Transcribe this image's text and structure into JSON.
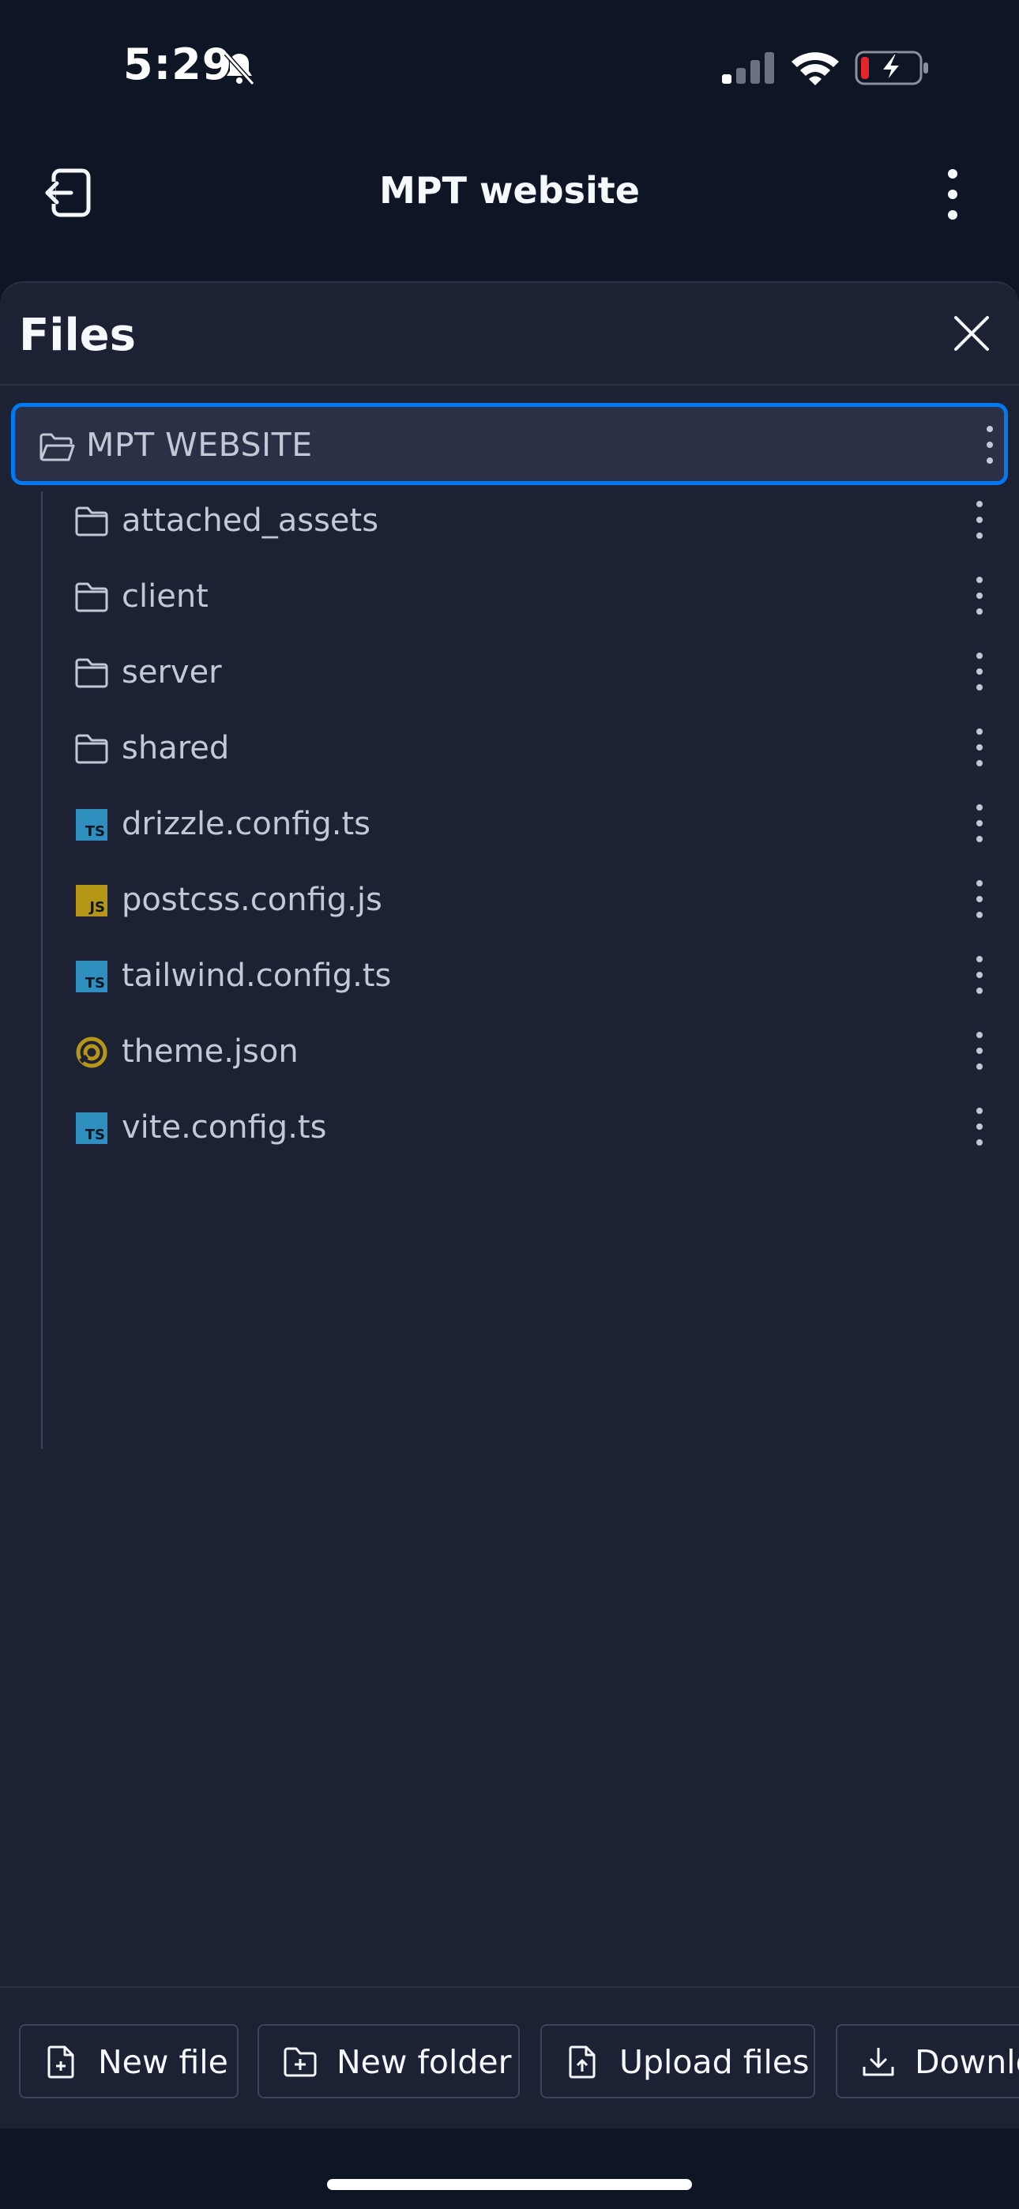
{
  "status_bar": {
    "time": "5:29",
    "icons": [
      "bell-slash-icon",
      "cellular-signal-icon",
      "wifi-icon",
      "battery-charging-icon"
    ]
  },
  "top_bar": {
    "title": "MPT website",
    "back_icon": "exit-arrow-icon",
    "menu_icon": "kebab-menu-icon"
  },
  "files_panel": {
    "title": "Files",
    "close_icon": "close-icon",
    "root": {
      "label": "MPT WEBSITE",
      "icon": "folder-open-icon"
    },
    "items": [
      {
        "label": "attached_assets",
        "type": "folder",
        "icon": "folder-icon"
      },
      {
        "label": "client",
        "type": "folder",
        "icon": "folder-icon"
      },
      {
        "label": "server",
        "type": "folder",
        "icon": "folder-icon"
      },
      {
        "label": "shared",
        "type": "folder",
        "icon": "folder-icon"
      },
      {
        "label": "drizzle.config.ts",
        "type": "ts",
        "icon": "typescript-icon",
        "badge": "TS"
      },
      {
        "label": "postcss.config.js",
        "type": "js",
        "icon": "javascript-icon",
        "badge": "JS"
      },
      {
        "label": "tailwind.config.ts",
        "type": "ts",
        "icon": "typescript-icon",
        "badge": "TS"
      },
      {
        "label": "theme.json",
        "type": "json",
        "icon": "json-icon"
      },
      {
        "label": "vite.config.ts",
        "type": "ts",
        "icon": "typescript-icon",
        "badge": "TS"
      }
    ]
  },
  "actions": [
    {
      "label": "New file",
      "icon": "file-plus-icon"
    },
    {
      "label": "New folder",
      "icon": "folder-plus-icon"
    },
    {
      "label": "Upload files",
      "icon": "file-upload-icon"
    },
    {
      "label": "Downlo",
      "icon": "download-icon"
    }
  ],
  "colors": {
    "background": "#0e1525",
    "panel": "#1c2233",
    "selected_row": "#2b3046",
    "accent": "#0079f2",
    "typescript": "#2f8fbf",
    "javascript": "#b59616",
    "json": "#b59616",
    "battery_low": "#e5252a"
  }
}
